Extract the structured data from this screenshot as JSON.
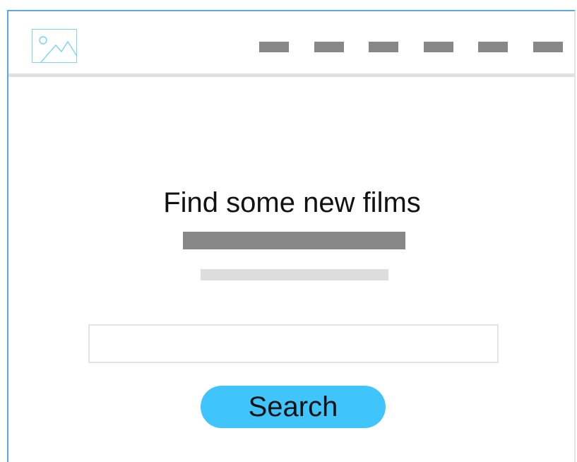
{
  "header": {
    "logo_icon": "image-placeholder-icon",
    "nav_items": [
      "",
      "",
      "",
      "",
      "",
      ""
    ]
  },
  "hero": {
    "title": "Find some new films",
    "subtitle": "",
    "description": ""
  },
  "search": {
    "value": "",
    "placeholder": "",
    "button_label": "Search"
  },
  "colors": {
    "frame_border": "#5aa9e6",
    "logo_stroke": "#7fd4f0",
    "nav_placeholder": "#878787",
    "divider": "#e0e0e0",
    "subtitle_placeholder": "#878787",
    "description_placeholder": "#dddddd",
    "input_border": "#e3e3e3",
    "button_background": "#3fc5fb",
    "text": "#111111"
  }
}
